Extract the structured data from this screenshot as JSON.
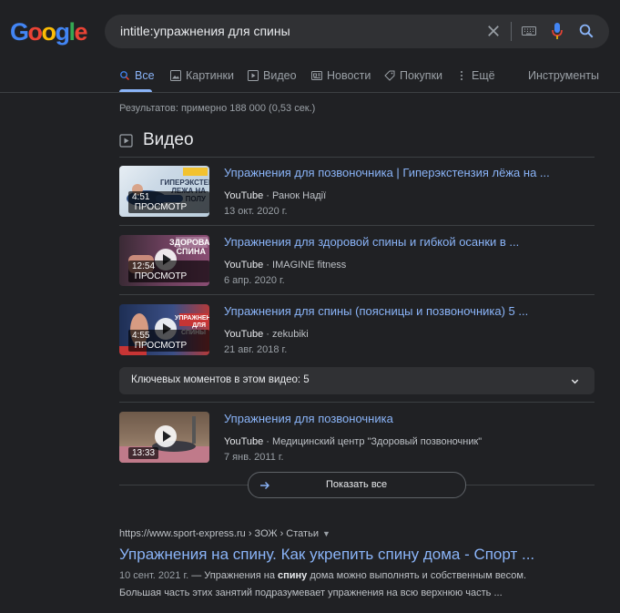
{
  "logo": {
    "letters": [
      "G",
      "o",
      "o",
      "g",
      "l",
      "e"
    ],
    "colors": [
      "#4285f4",
      "#ea4335",
      "#fbbc05",
      "#4285f4",
      "#34a853",
      "#ea4335"
    ]
  },
  "search": {
    "query": "intitle:упражнения для спины"
  },
  "tabs": [
    {
      "label": "Все",
      "icon": "search-icon",
      "active": true
    },
    {
      "label": "Картинки",
      "icon": "image-icon"
    },
    {
      "label": "Видео",
      "icon": "video-icon"
    },
    {
      "label": "Новости",
      "icon": "news-icon"
    },
    {
      "label": "Покупки",
      "icon": "tag-icon"
    },
    {
      "label": "Ещё",
      "icon": "more-vert-icon"
    }
  ],
  "tools_label": "Инструменты",
  "results_count": "Результатов: примерно 188 000 (0,53 сек.)",
  "video_section": {
    "title": "Видео",
    "items": [
      {
        "title": "Упражнения для позвоночника | Гиперэкстензия лёжа на ...",
        "source": "YouTube",
        "channel": " · Ранок Надії",
        "date": "13 окт. 2020 г.",
        "duration": "4:51",
        "thumb_text": "ГИПЕРЭКСТЕНЗИЯ ЛЕЖА НА ПОЛУ",
        "preview_label": "ПРОСМОТР"
      },
      {
        "title": "Упражнения для здоровой спины и гибкой осанки в ...",
        "source": "YouTube",
        "channel": " · IMAGINE fitness",
        "date": "6 апр. 2020 г.",
        "duration": "12:54",
        "thumb_text": "ЗДОРОВАЯ СПИНА",
        "preview_label": "ПРОСМОТР"
      },
      {
        "title": "Упражнения для спины (поясницы и позвоночника) 5 ...",
        "source": "YouTube",
        "channel": " · zekubiki",
        "date": "21 авг. 2018 г.",
        "duration": "4:55",
        "thumb_text": "УПРАЖНЕНИЯ ДЛЯ СПИНЫ",
        "preview_label": "ПРОСМОТР"
      },
      {
        "title": "Упражнения для позвоночника",
        "source": "YouTube",
        "channel": " · Медицинский центр \"Здоровый позвоночник\"",
        "date": "7 янв. 2011 г.",
        "duration": "13:33",
        "thumb_text": "",
        "preview_label": ""
      }
    ],
    "key_moments": "Ключевых моментов в этом видео: 5",
    "show_all": "Показать все"
  },
  "web_result": {
    "url": "https://www.sport-express.ru › ЗОЖ › Статьи",
    "title": "Упражнения на спину. Как укрепить спину дома - Спорт ...",
    "date": "10 сент. 2021 г.",
    "snippet_pre": " — Упражнения на ",
    "snippet_bold": "спину",
    "snippet_post": " дома можно выполнять и собственным весом.",
    "snippet_line2": "Большая часть этих занятий подразумевает упражнения на всю верхнюю часть ..."
  }
}
